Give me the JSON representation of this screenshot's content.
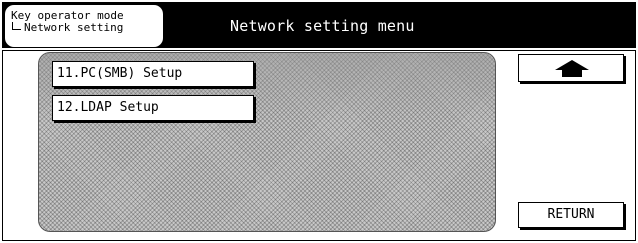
{
  "header": {
    "breadcrumb_top": "Key operator mode",
    "breadcrumb_sub": "Network setting",
    "title": "Network setting menu"
  },
  "menu": {
    "items": [
      {
        "label": "11.PC(SMB) Setup"
      },
      {
        "label": "12.LDAP Setup"
      }
    ]
  },
  "controls": {
    "up_icon": "up-arrow-icon",
    "return_label": "RETURN"
  },
  "colors": {
    "title_bar": "#000000",
    "panel": "#c8c8c8",
    "button_bg": "#ffffff"
  }
}
